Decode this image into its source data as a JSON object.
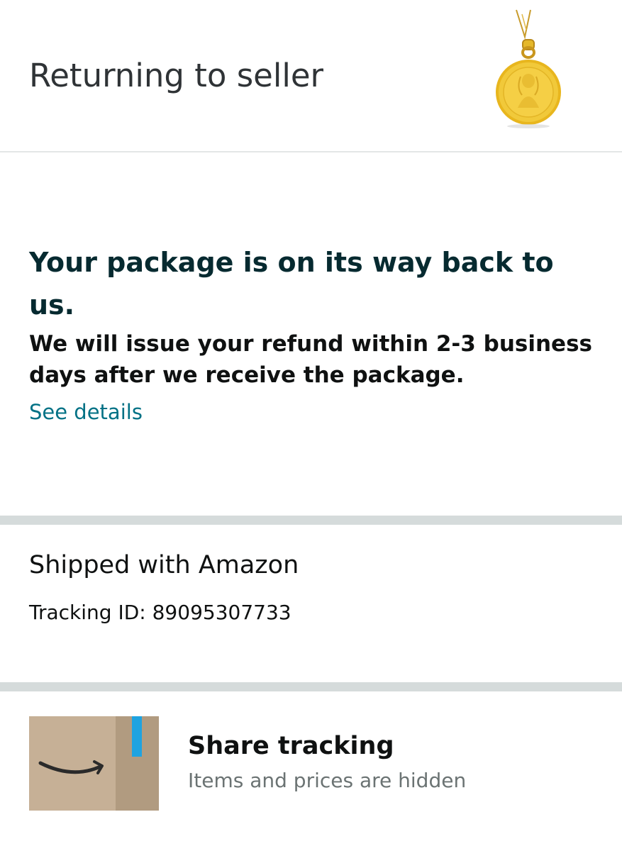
{
  "header": {
    "title": "Returning to seller",
    "product_image_icon": "gold-pendant-thumbnail"
  },
  "status": {
    "headline": "Your package is on its way back to us.",
    "subtext": "We will issue your refund within 2-3 business days after we receive the package.",
    "details_link": "See details"
  },
  "shipment": {
    "carrier": "Shipped with Amazon",
    "tracking": "Tracking ID: 89095307733"
  },
  "share": {
    "icon": "amazon-box-icon",
    "title": "Share tracking",
    "subtitle": "Items and prices are hidden"
  },
  "colors": {
    "link": "#007185",
    "divider": "#d5dbdb",
    "headline": "#062a30",
    "muted": "#6b7373"
  }
}
